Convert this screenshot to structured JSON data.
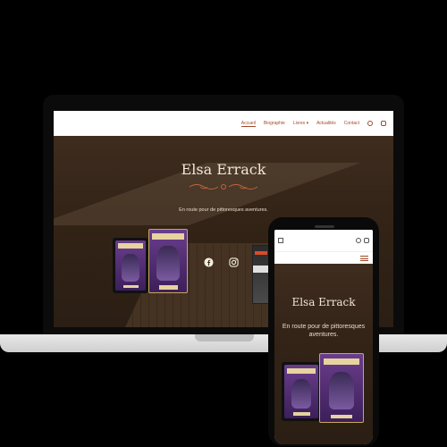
{
  "desktop": {
    "nav": {
      "items": [
        {
          "label": "Accueil",
          "active": true
        },
        {
          "label": "Biographie",
          "active": false
        },
        {
          "label": "Livres",
          "active": false
        },
        {
          "label": "Actualités",
          "active": false
        },
        {
          "label": "Contact",
          "active": false
        }
      ],
      "dropdown_marker": "▾"
    },
    "hero": {
      "title": "Elsa Errack",
      "subtitle": "En route pour de pittoresques aventures."
    }
  },
  "phone": {
    "hero": {
      "title": "Elsa Errack",
      "subtitle": "En route pour de pittoresques aventures."
    }
  },
  "colors": {
    "accent": "#a24a2a",
    "hero_text": "#f1e6d8",
    "book_purple": "#6a3d8c"
  },
  "icons": [
    "facebook-icon",
    "instagram-icon",
    "menu-icon",
    "flourish-ornament"
  ]
}
